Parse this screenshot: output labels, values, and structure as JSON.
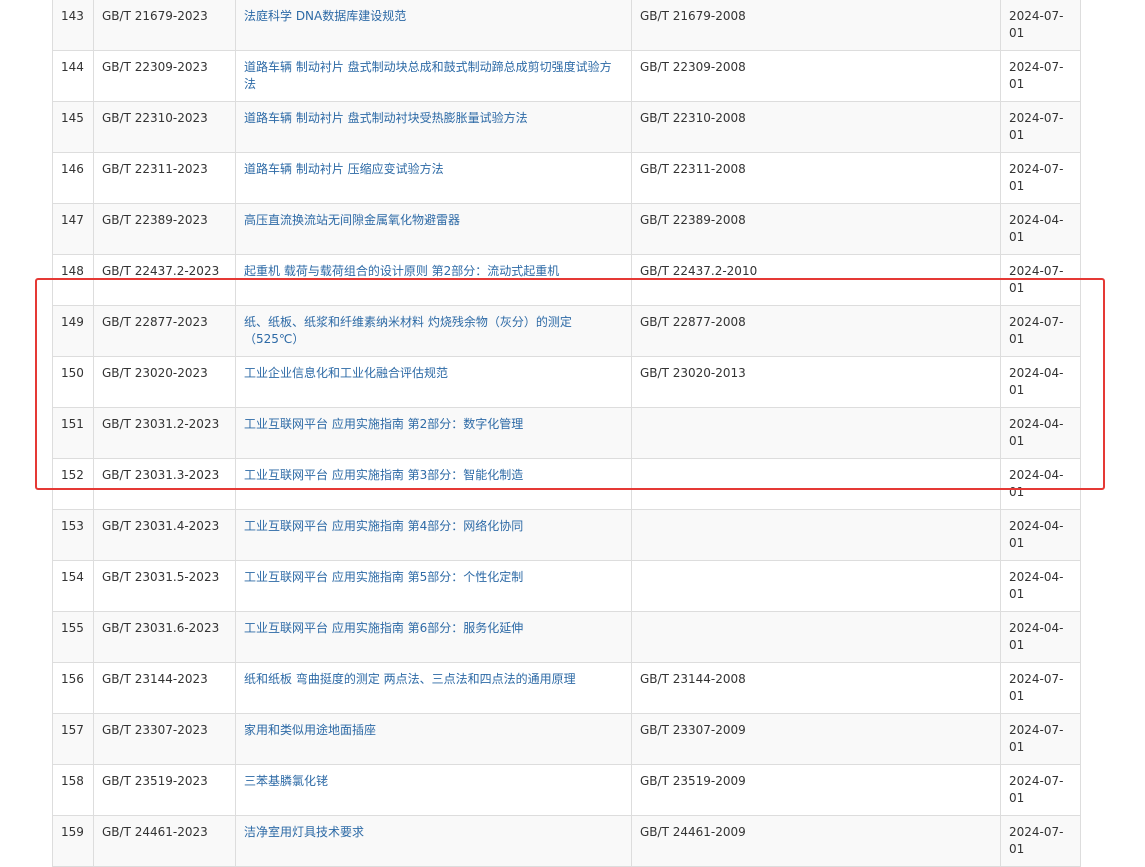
{
  "rows": [
    {
      "no": "143",
      "code": "GB/T 21679-2023",
      "title": "法庭科学 DNA数据库建设规范",
      "replaces": "GB/T 21679-2008",
      "date": "2024-07-01"
    },
    {
      "no": "144",
      "code": "GB/T 22309-2023",
      "title": "道路车辆 制动衬片 盘式制动块总成和鼓式制动蹄总成剪切强度试验方法",
      "replaces": "GB/T 22309-2008",
      "date": "2024-07-01"
    },
    {
      "no": "145",
      "code": "GB/T 22310-2023",
      "title": "道路车辆 制动衬片 盘式制动衬块受热膨胀量试验方法",
      "replaces": "GB/T 22310-2008",
      "date": "2024-07-01"
    },
    {
      "no": "146",
      "code": "GB/T 22311-2023",
      "title": "道路车辆 制动衬片 压缩应变试验方法",
      "replaces": "GB/T 22311-2008",
      "date": "2024-07-01"
    },
    {
      "no": "147",
      "code": "GB/T 22389-2023",
      "title": "高压直流换流站无间隙金属氧化物避雷器",
      "replaces": "GB/T 22389-2008",
      "date": "2024-04-01"
    },
    {
      "no": "148",
      "code": "GB/T 22437.2-2023",
      "title": "起重机 载荷与载荷组合的设计原则 第2部分：流动式起重机",
      "replaces": "GB/T 22437.2-2010",
      "date": "2024-07-01"
    },
    {
      "no": "149",
      "code": "GB/T 22877-2023",
      "title": "纸、纸板、纸浆和纤维素纳米材料 灼烧残余物（灰分）的测定（525℃）",
      "replaces": "GB/T 22877-2008",
      "date": "2024-07-01"
    },
    {
      "no": "150",
      "code": "GB/T 23020-2023",
      "title": "工业企业信息化和工业化融合评估规范",
      "replaces": "GB/T 23020-2013",
      "date": "2024-04-01"
    },
    {
      "no": "151",
      "code": "GB/T 23031.2-2023",
      "title": "工业互联网平台 应用实施指南 第2部分：数字化管理",
      "replaces": "",
      "date": "2024-04-01"
    },
    {
      "no": "152",
      "code": "GB/T 23031.3-2023",
      "title": "工业互联网平台 应用实施指南 第3部分：智能化制造",
      "replaces": "",
      "date": "2024-04-01"
    },
    {
      "no": "153",
      "code": "GB/T 23031.4-2023",
      "title": "工业互联网平台 应用实施指南 第4部分：网络化协同",
      "replaces": "",
      "date": "2024-04-01"
    },
    {
      "no": "154",
      "code": "GB/T 23031.5-2023",
      "title": "工业互联网平台 应用实施指南 第5部分：个性化定制",
      "replaces": "",
      "date": "2024-04-01"
    },
    {
      "no": "155",
      "code": "GB/T 23031.6-2023",
      "title": "工业互联网平台 应用实施指南 第6部分：服务化延伸",
      "replaces": "",
      "date": "2024-04-01"
    },
    {
      "no": "156",
      "code": "GB/T 23144-2023",
      "title": "纸和纸板 弯曲挺度的测定 两点法、三点法和四点法的通用原理",
      "replaces": "GB/T 23144-2008",
      "date": "2024-07-01"
    },
    {
      "no": "157",
      "code": "GB/T 23307-2023",
      "title": "家用和类似用途地面插座",
      "replaces": "GB/T 23307-2009",
      "date": "2024-07-01"
    },
    {
      "no": "158",
      "code": "GB/T 23519-2023",
      "title": "三苯基膦氯化铑",
      "replaces": "GB/T 23519-2009",
      "date": "2024-07-01"
    },
    {
      "no": "159",
      "code": "GB/T 24461-2023",
      "title": "洁净室用灯具技术要求",
      "replaces": "GB/T 24461-2009",
      "date": "2024-07-01"
    }
  ],
  "highlight_color": "#e53935",
  "link_color": "#2d6aa6"
}
